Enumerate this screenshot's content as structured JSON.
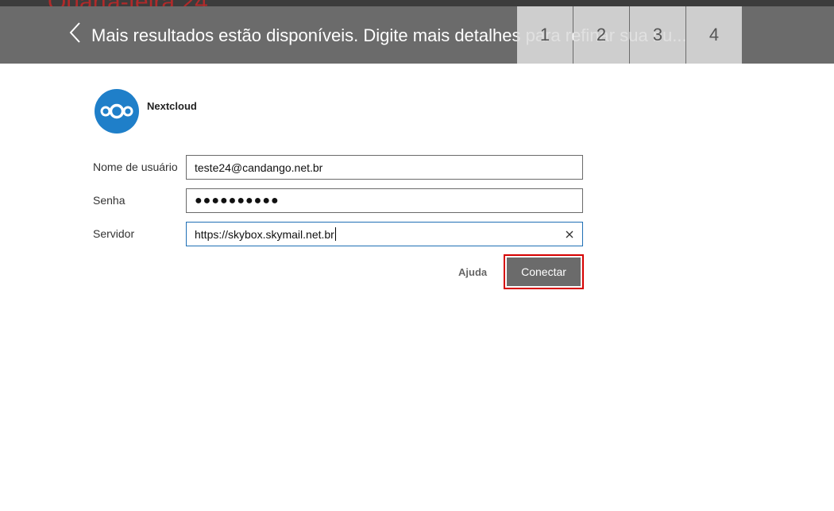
{
  "header": {
    "title": "Mais resultados estão disponíveis. Digite mais detalhes para refinar sua bu...",
    "pages": [
      "1",
      "2",
      "3",
      "4"
    ]
  },
  "brand": {
    "name": "Nextcloud"
  },
  "form": {
    "username_label": "Nome de usuário",
    "username_value": "teste24@candango.net.br",
    "password_label": "Senha",
    "password_value": "●●●●●●●●●●",
    "server_label": "Servidor",
    "server_value": "https://skybox.skymail.net.br"
  },
  "actions": {
    "help_label": "Ajuda",
    "connect_label": "Conectar"
  },
  "colors": {
    "header_bg": "#6b6b6b",
    "logo_blue": "#1f7fc9",
    "highlight_red": "#d60000"
  }
}
